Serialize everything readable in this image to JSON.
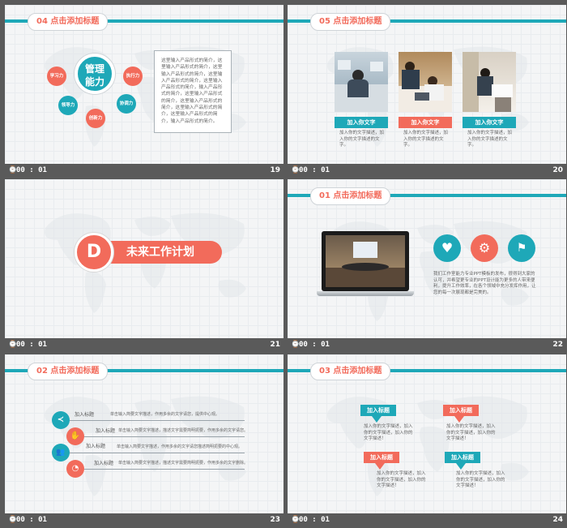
{
  "slides": [
    {
      "num": "19",
      "time": "00 : 01",
      "title": "04 点击添加标题",
      "center": "管理能力",
      "skills": [
        "学习力",
        "执行力",
        "领导力",
        "协调力",
        "创新力"
      ],
      "text": "这里输入产品形式的简介，这里输入产品形式的简介，这里输入产品形式的简介，这里输入产品形式的简介，这里输入产品形式的简介，输入产品形式的简介，这里输入产品形式的简介，这里输入产品形式的简介，这里输入产品形式的简介，这里输入产品形式的简介，输入产品形式的简介。"
    },
    {
      "num": "20",
      "time": "00 : 01",
      "title": "05 点击添加标题",
      "cards": [
        {
          "label": "加入你文字",
          "text": "加入你的文字描述，加入你的文字描述的文字。"
        },
        {
          "label": "加入你文字",
          "text": "加入你的文字描述，加入你的文字描述的文字。"
        },
        {
          "label": "加入你文字",
          "text": "加入你的文字描述，加入你的文字描述的文字。"
        }
      ]
    },
    {
      "num": "21",
      "time": "00 : 01",
      "letter": "D",
      "heading": "未来工作计划"
    },
    {
      "num": "22",
      "time": "00 : 01",
      "title": "01 点击添加标题",
      "text": "我们工作室能力专业PPT模板的发布，很得到大家的认可，并希望更专业的PPT设计能为更多的人带来便利，提升工作效率，在各个领域中充分发挥作用，让您的每一次展现都是完美的。"
    },
    {
      "num": "23",
      "time": "00 : 01",
      "title": "02 点击添加标题",
      "rows": [
        {
          "label": "加入标题",
          "text": "单击输入简要文字描述，作用多余的文字请您，提供中心观。"
        },
        {
          "label": "加入标题",
          "text": "单击输入简要文字描述，描述文字需要简明扼要，作用多余的文字请您。"
        },
        {
          "label": "加入标题",
          "text": "单击输入简要文字描述，作用多余的文字请您描述简明扼要的中心观。"
        },
        {
          "label": "加入标题",
          "text": "单击输入简要文字描述，描述文字需要简明扼要，作用多余的文字删除。"
        }
      ]
    },
    {
      "num": "24",
      "time": "00 : 01",
      "title": "03 点击添加标题",
      "callouts": [
        {
          "label": "加入标题",
          "text": "加入你的文字描述，加入你的文字描述，加入你的文字描述！"
        },
        {
          "label": "加入标题",
          "text": "加入你的文字描述，加入你的文字描述，加入你的文字描述！"
        },
        {
          "label": "加入标题",
          "text": "加入你的文字描述，加入你的文字描述，加入你的文字描述！"
        },
        {
          "label": "加入标题",
          "text": "加入你的文字描述，加入你的文字描述，加入你的文字描述！"
        }
      ]
    }
  ],
  "colors": {
    "teal": "#1ea8b8",
    "coral": "#f26b5b",
    "background": "#5a5a5a"
  },
  "icons": [
    "clock-icon",
    "heart-icon",
    "gear-icon",
    "flag-icon",
    "share-icon",
    "hand-icon",
    "users-icon",
    "chart-icon"
  ]
}
